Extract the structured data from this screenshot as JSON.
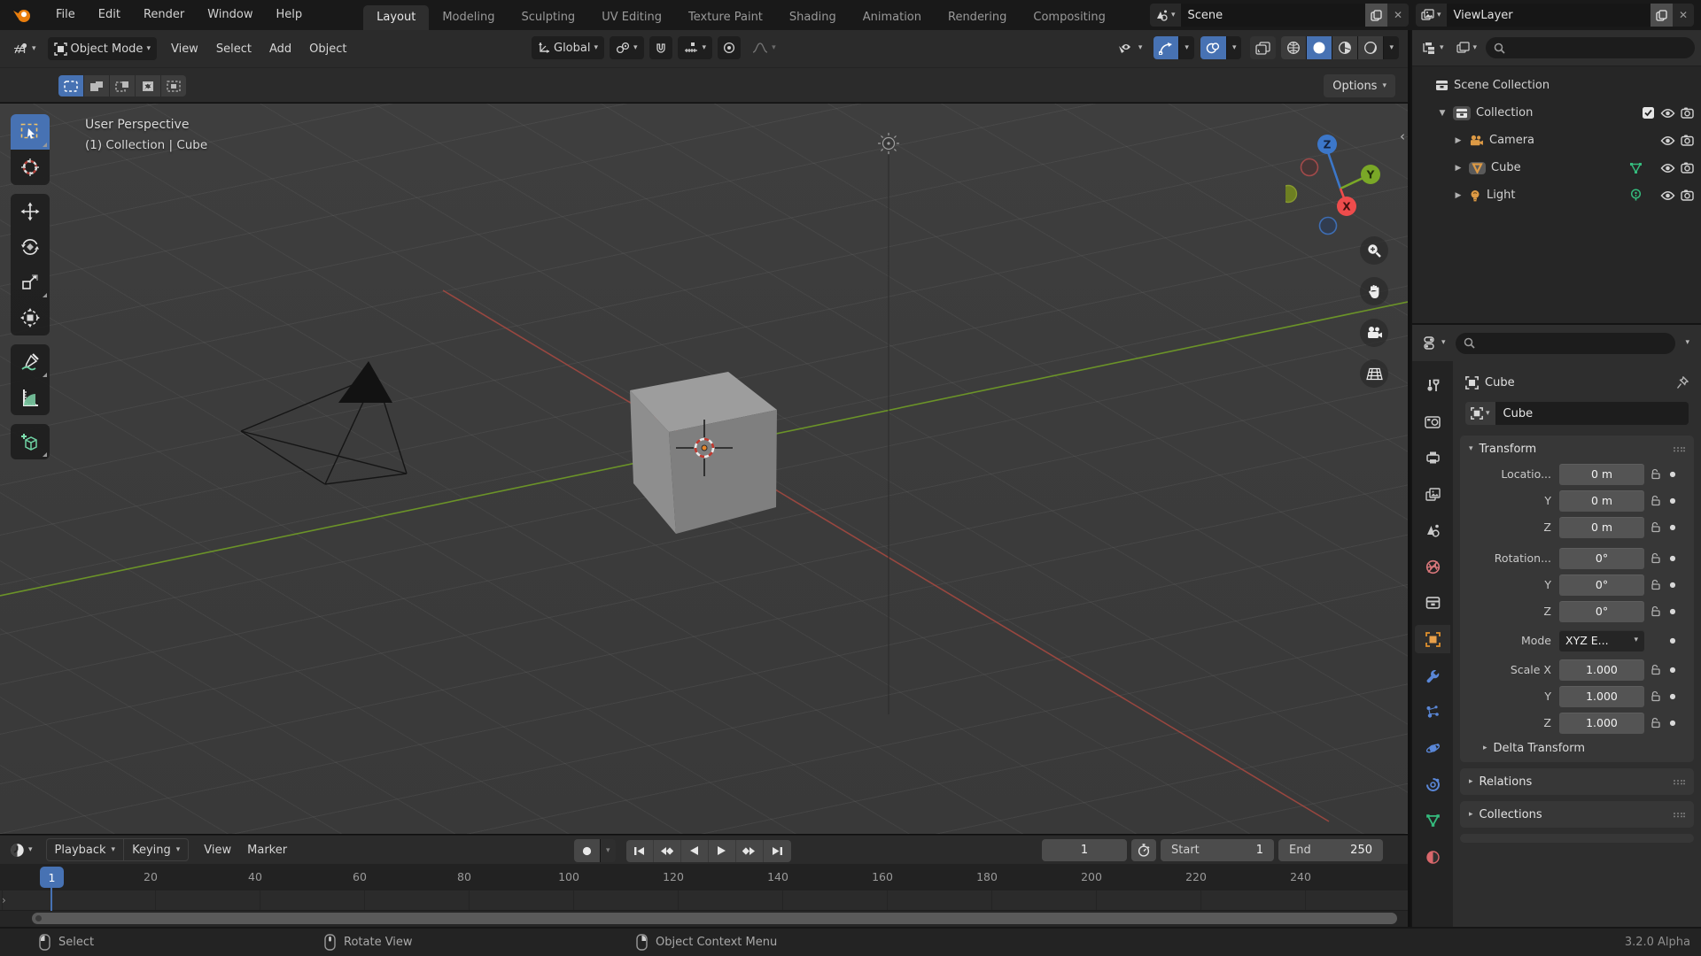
{
  "topbar": {
    "menus": [
      "File",
      "Edit",
      "Render",
      "Window",
      "Help"
    ],
    "tabs": [
      {
        "label": "Layout",
        "active": true
      },
      {
        "label": "Modeling"
      },
      {
        "label": "Sculpting"
      },
      {
        "label": "UV Editing"
      },
      {
        "label": "Texture Paint"
      },
      {
        "label": "Shading"
      },
      {
        "label": "Animation"
      },
      {
        "label": "Rendering"
      },
      {
        "label": "Compositing"
      }
    ],
    "scene": {
      "label": "Scene"
    },
    "view_layer": {
      "label": "ViewLayer"
    }
  },
  "viewport_header": {
    "mode": "Object Mode",
    "menus": [
      "View",
      "Select",
      "Add",
      "Object"
    ],
    "orientation": "Global"
  },
  "tool_settings": {
    "options": "Options"
  },
  "viewport": {
    "perspective": "User Perspective",
    "context": "(1) Collection | Cube",
    "axes": {
      "x": "X",
      "y": "Y",
      "z": "Z"
    }
  },
  "outliner": {
    "root": "Scene Collection",
    "items": [
      {
        "name": "Collection"
      },
      {
        "name": "Camera"
      },
      {
        "name": "Cube"
      },
      {
        "name": "Light"
      }
    ]
  },
  "properties": {
    "breadcrumb": "Cube",
    "object_name": "Cube",
    "transform": {
      "title": "Transform",
      "location": [
        {
          "label": "Locatio...",
          "value": "0 m"
        },
        {
          "label": "Y",
          "value": "0 m"
        },
        {
          "label": "Z",
          "value": "0 m"
        }
      ],
      "rotation": [
        {
          "label": "Rotation...",
          "value": "0°"
        },
        {
          "label": "Y",
          "value": "0°"
        },
        {
          "label": "Z",
          "value": "0°"
        }
      ],
      "mode": {
        "label": "Mode",
        "value": "XYZ E..."
      },
      "scale": [
        {
          "label": "Scale X",
          "value": "1.000"
        },
        {
          "label": "Y",
          "value": "1.000"
        },
        {
          "label": "Z",
          "value": "1.000"
        }
      ],
      "delta": "Delta Transform"
    },
    "panels": [
      "Relations",
      "Collections"
    ]
  },
  "timeline": {
    "menus": [
      "Playback",
      "Keying",
      "View",
      "Marker"
    ],
    "frame": "1",
    "start_label": "Start",
    "start_value": "1",
    "end_label": "End",
    "end_value": "250",
    "playhead": "1",
    "ticks": [
      "20",
      "40",
      "60",
      "80",
      "100",
      "120",
      "140",
      "160",
      "180",
      "200",
      "220",
      "240"
    ]
  },
  "statusbar": {
    "items": [
      "Select",
      "Rotate View",
      "Object Context Menu"
    ],
    "version": "3.2.0 Alpha"
  },
  "colors": {
    "accent": "#4772b3",
    "axis_x": "#ee4c4c",
    "axis_y": "#7aa827",
    "axis_z": "#3c77c9",
    "object_orange": "#dd9a45",
    "data_green": "#35bb7d"
  }
}
